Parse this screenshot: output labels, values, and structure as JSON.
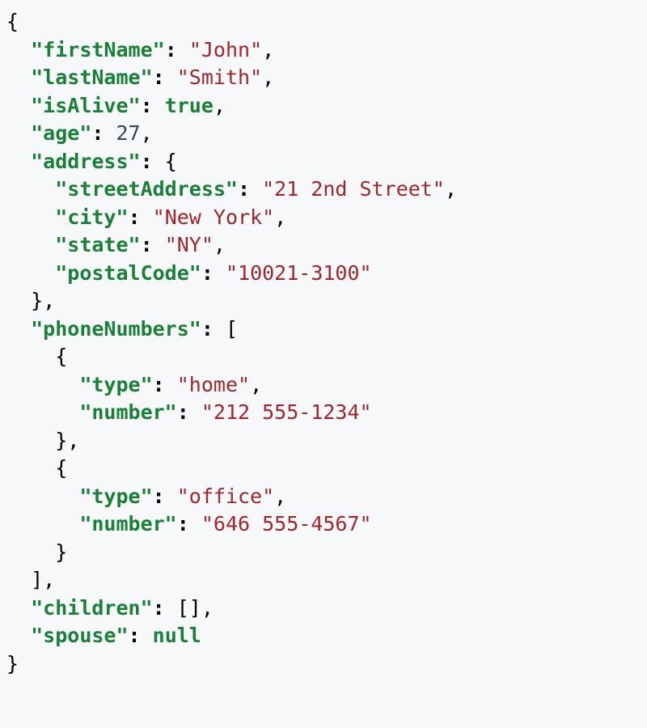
{
  "json": {
    "firstName": {
      "key": "\"firstName\"",
      "value": "\"John\"",
      "type": "string"
    },
    "lastName": {
      "key": "\"lastName\"",
      "value": "\"Smith\"",
      "type": "string"
    },
    "isAlive": {
      "key": "\"isAlive\"",
      "value": "true",
      "type": "boolean"
    },
    "age": {
      "key": "\"age\"",
      "value": "27",
      "type": "number"
    },
    "address": {
      "key": "\"address\"",
      "streetAddress": {
        "key": "\"streetAddress\"",
        "value": "\"21 2nd Street\""
      },
      "city": {
        "key": "\"city\"",
        "value": "\"New York\""
      },
      "state": {
        "key": "\"state\"",
        "value": "\"NY\""
      },
      "postalCode": {
        "key": "\"postalCode\"",
        "value": "\"10021-3100\""
      }
    },
    "phoneNumbers": {
      "key": "\"phoneNumbers\"",
      "items": [
        {
          "type": {
            "key": "\"type\"",
            "value": "\"home\""
          },
          "number": {
            "key": "\"number\"",
            "value": "\"212 555-1234\""
          }
        },
        {
          "type": {
            "key": "\"type\"",
            "value": "\"office\""
          },
          "number": {
            "key": "\"number\"",
            "value": "\"646 555-4567\""
          }
        }
      ]
    },
    "children": {
      "key": "\"children\"",
      "value": "[]",
      "type": "array"
    },
    "spouse": {
      "key": "\"spouse\"",
      "value": "null",
      "type": "null"
    }
  },
  "punct": {
    "open_brace": "{",
    "close_brace": "}",
    "open_bracket": "[",
    "close_bracket": "]",
    "colon": ":",
    "comma": ","
  }
}
